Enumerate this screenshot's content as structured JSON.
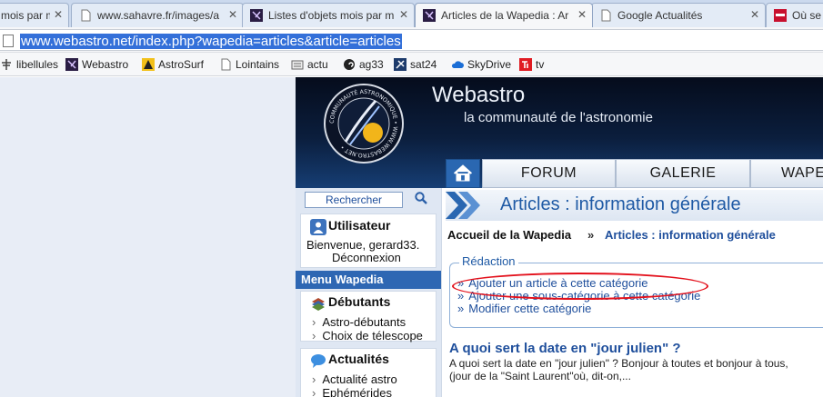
{
  "browser": {
    "tabs": [
      {
        "title": "mois par m",
        "active": false
      },
      {
        "title": "www.sahavre.fr/images/a",
        "active": false
      },
      {
        "title": "Listes d'objets mois par m",
        "active": false
      },
      {
        "title": "Articles de la Wapedia : Ar",
        "active": true
      },
      {
        "title": "Google Actualités",
        "active": false
      },
      {
        "title": "Où se t",
        "active": false
      }
    ],
    "url": "www.webastro.net/index.php?wapedia=articles&article=articles",
    "bookmarks": [
      "libellules",
      "Webastro",
      "AstroSurf",
      "Lointains",
      "actu",
      "ag33",
      "sat24",
      "SkyDrive",
      "tv"
    ]
  },
  "site": {
    "logo_text": "COMMUNAUTÉ ASTRONOMIQUE • WWW.WEBASTRO.NET •",
    "title": "Webastro",
    "tagline": "la communauté de l'astronomie",
    "nav": [
      "FORUM",
      "GALERIE",
      "WAPE"
    ]
  },
  "sidebar": {
    "search_label": "Rechercher",
    "user": {
      "title": "Utilisateur",
      "welcome": "Bienvenue, gerard33.",
      "logout": "Déconnexion"
    },
    "menu_title": "Menu Wapedia",
    "sections": [
      {
        "title": "Débutants",
        "items": [
          "Astro-débutants",
          "Choix de télescope"
        ]
      },
      {
        "title": "Actualités",
        "items": [
          "Actualité astro",
          "Ephémérides"
        ]
      }
    ]
  },
  "main": {
    "title": "Articles : information générale",
    "breadcrumb": {
      "home": "Accueil de la Wapedia",
      "sep": "»",
      "current": "Articles : information générale"
    },
    "redaction": {
      "legend": "Rédaction",
      "links": [
        "Ajouter un article à cette catégorie",
        "Ajouter une sous-catégorie à cette catégorie",
        "Modifier cette catégorie"
      ]
    },
    "article": {
      "title": "A quoi sert la date en \"jour julien\" ?",
      "excerpt_line1": "A quoi sert la date en \"jour julien\" ? Bonjour à toutes et bonjour à tous,",
      "excerpt_line2": "(jour de la \"Saint Laurent\"où, dit-on,..."
    }
  },
  "colors": {
    "accent": "#1f5aa5",
    "menu_bg": "#2e67b3",
    "highlight_ellipse": "#e3101b"
  }
}
